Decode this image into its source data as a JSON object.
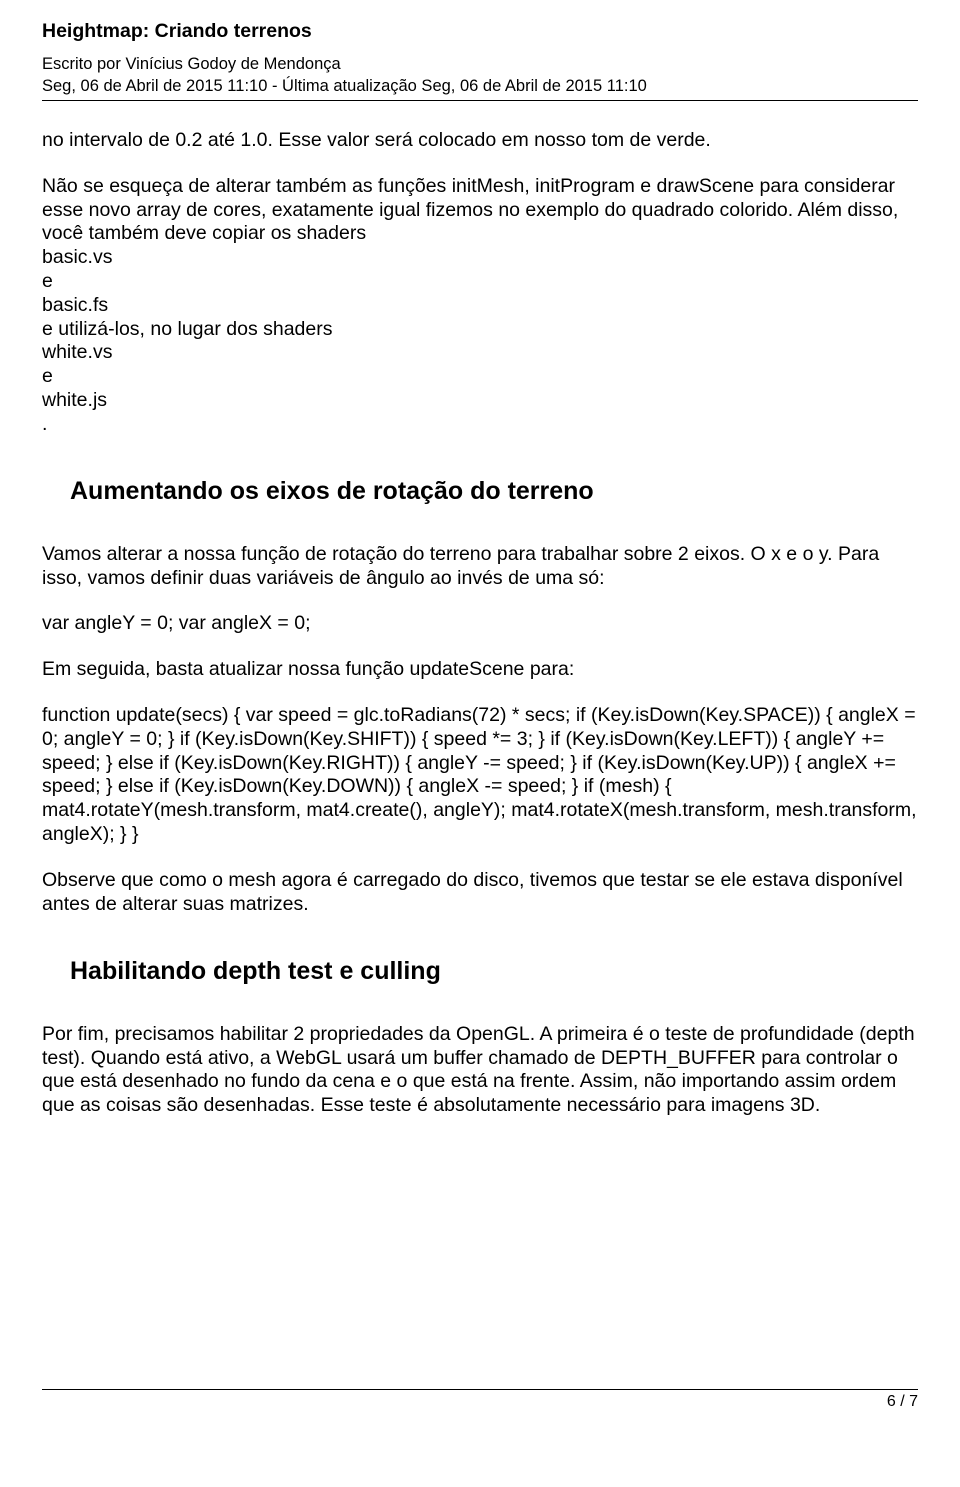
{
  "header": {
    "title": "Heightmap: Criando terrenos",
    "author_line": "Escrito por Vinícius Godoy de Mendonça",
    "date_line": "Seg, 06 de Abril de 2015 11:10 - Última atualização Seg, 06 de Abril de 2015 11:10"
  },
  "body": {
    "p1": "no intervalo de 0.2 até 1.0. Esse valor será colocado em nosso tom de verde.",
    "p2": "Não se esqueça de alterar também as funções initMesh, initProgram e drawScene para considerar esse novo array de cores, exatamente igual fizemos no exemplo do quadrado colorido. Além disso, você também deve copiar os shaders",
    "p2_lines": {
      "l1": "basic.vs",
      "l2": "e",
      "l3": "basic.fs",
      "l4": "e utilizá-los, no lugar dos shaders",
      "l5": "white.vs",
      "l6": "e",
      "l7": "white.js",
      "l8": "."
    },
    "h1": "Aumentando os eixos de rotação do terreno",
    "p3": "Vamos alterar a nossa função de rotação do terreno para trabalhar sobre 2 eixos. O x e o y. Para isso, vamos definir duas variáveis de ângulo ao invés de uma só:",
    "code1": "var angleY = 0;  var angleX = 0;",
    "p4": "Em seguida, basta atualizar nossa função updateScene para:",
    "code2": "function update(secs) {        var speed = glc.toRadians(72) * secs;        if (Key.isDown(Key.SPACE)) {            angleX = 0;            angleY = 0;        }          if (Key.isDown(Key.SHIFT)) {            speed *= 3;        }             if (Key.isDown(Key.LEFT)) { angleY += speed;        } else if (Key.isDown(Key.RIGHT)) {            angleY -= speed;        }              if (Key.isDown(Key.UP)) {            angleX += speed;        } else if (Key.isDown(Key.DOWN)) { angleX -= speed;        }          if (mesh) {            mat4.rotateY(mesh.transform, mat4.create(), angleY);            mat4.rotateX(mesh.transform, mesh.transform, angleX);        } }",
    "p5": "Observe que como o mesh agora é carregado do disco, tivemos que testar se ele estava disponível antes de alterar suas matrizes.",
    "h2": "Habilitando depth test e culling",
    "p6": "Por fim, precisamos habilitar 2 propriedades da OpenGL. A primeira é o teste de profundidade (depth test). Quando está ativo, a WebGL usará um buffer chamado de DEPTH_BUFFER para controlar o que está desenhado no fundo da cena e o que está na frente. Assim, não importando assim ordem que as coisas são desenhadas. Esse teste é absolutamente necessário para imagens 3D."
  },
  "footer": {
    "page": "6 / 7"
  }
}
